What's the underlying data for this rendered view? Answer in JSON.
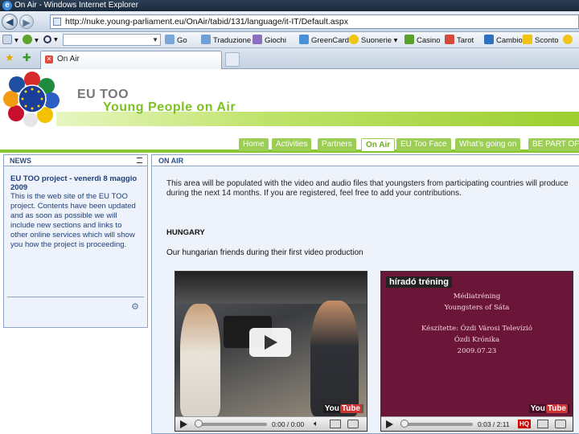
{
  "window": {
    "title": "On Air - Windows Internet Explorer"
  },
  "address": {
    "url": "http://nuke.young-parliament.eu/OnAir/tabid/131/language/it-IT/Default.aspx"
  },
  "toolbar": {
    "go_label": "Go",
    "items": [
      "Traduzione",
      "Giochi",
      "GreenCard",
      "Suonerie",
      "Casino",
      "Tarot",
      "Cambio",
      "Sconto"
    ]
  },
  "tab": {
    "label": "On Air"
  },
  "site": {
    "brand_line1": "EU TOO",
    "brand_line2": "Young People on Air",
    "menu": [
      "Home",
      "Activities",
      "Partners",
      "On Air",
      "EU Too Face",
      "What's going on",
      "BE PART OF"
    ],
    "active_menu": "On Air"
  },
  "news": {
    "header": "NEWS",
    "title": "EU TOO project - venerdì 8 maggio 2009",
    "body": "This is the web site of the EU TOO project. Contents have been updated and as soon as possible we will include new sections and links to other online services which will show you how the project is proceeding."
  },
  "main": {
    "header": "ON AIR",
    "intro": "This area will be populated with the video and audio files that youngsters from participating countries will produce during the next 14 months. If you are registered, feel free to add your contributions.",
    "country": "HUNGARY",
    "caption": "Our hungarian friends during their first video production"
  },
  "videos": [
    {
      "time": "0:00 / 0:00",
      "logo": "You"
    },
    {
      "chip": "híradó tréning",
      "lines": [
        "Médiatréning",
        "Youngsters of Sáta",
        "",
        "Készítette: Ózdi Városi Televízió",
        "Ózdi Krónika",
        "2009.07.23"
      ],
      "time": "0:03 / 2:11",
      "hq": "HQ",
      "logo": "You"
    }
  ]
}
